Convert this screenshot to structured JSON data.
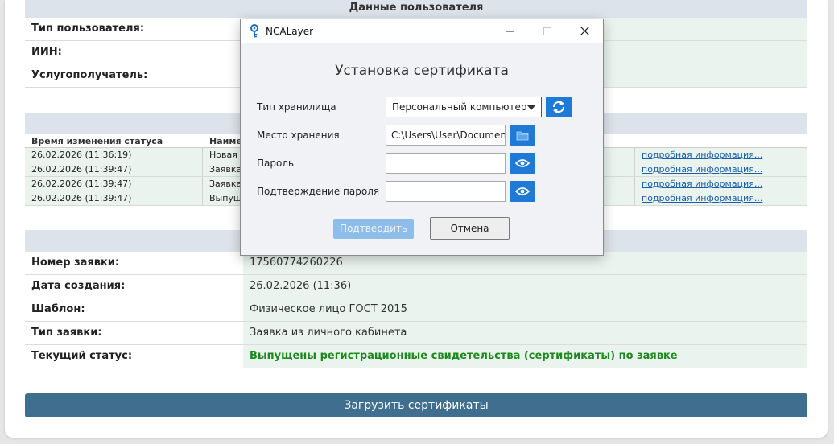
{
  "user_section": {
    "title": "Данные пользователя",
    "rows": [
      {
        "label": "Тип пользователя:",
        "value": ""
      },
      {
        "label": "ИИН:",
        "value": ""
      },
      {
        "label": "Услугополучатель:",
        "value": ""
      }
    ]
  },
  "history": {
    "headers": [
      "Время изменения статуса",
      "Наиме",
      ""
    ],
    "rows": [
      {
        "time": "26.02.2026 (11:36:19)",
        "name": "Новая",
        "link": "подробная информация..."
      },
      {
        "time": "26.02.2026 (11:39:47)",
        "name": "Заявка",
        "link": "подробная информация..."
      },
      {
        "time": "26.02.2026 (11:39:47)",
        "name": "Заявка",
        "link": "подробная информация..."
      },
      {
        "time": "26.02.2026 (11:39:47)",
        "name": "Выпуш",
        "link": "подробная информация..."
      }
    ]
  },
  "request": {
    "rows": [
      {
        "label": "Номер заявки:",
        "value": "17560774260226"
      },
      {
        "label": "Дата создания:",
        "value": "26.02.2026 (11:36)"
      },
      {
        "label": "Шаблон:",
        "value": "Физическое лицо ГОСТ 2015"
      },
      {
        "label": "Тип заявки:",
        "value": "Заявка из личного кабинета"
      },
      {
        "label": "Текущий статус:",
        "value": "Выпущены регистрационные свидетельства (сертификаты) по заявке"
      }
    ]
  },
  "download_button": "Загрузить сертификаты",
  "dialog": {
    "window_title": "NCALayer",
    "heading": "Установка сертификата",
    "storage_type_label": "Тип хранилища",
    "storage_type_value": "Персональный компьютер",
    "location_label": "Место хранения",
    "location_value": "C:\\Users\\User\\Documents",
    "password_label": "Пароль",
    "password_value": "",
    "confirm_password_label": "Подтверждение пароля",
    "confirm_password_value": "",
    "confirm_button": "Подтвердить",
    "cancel_button": "Отмена"
  },
  "colors": {
    "accent": "#1e7ad6",
    "primary_button": "#3f6e8e",
    "status_green": "#1a8a1a",
    "link": "#1a5fa8"
  }
}
